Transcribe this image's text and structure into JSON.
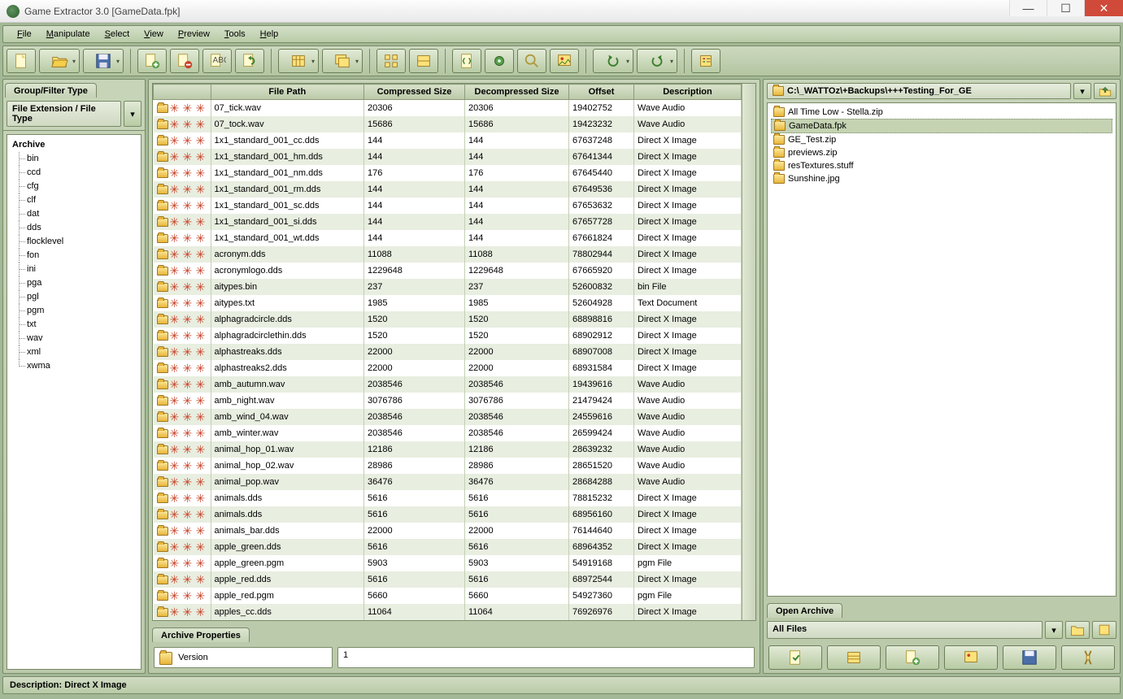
{
  "window": {
    "title": "Game Extractor 3.0 [GameData.fpk]"
  },
  "menu": {
    "items": [
      "File",
      "Manipulate",
      "Select",
      "View",
      "Preview",
      "Tools",
      "Help"
    ]
  },
  "left": {
    "tab": "Group/Filter Type",
    "selector": "File Extension / File Type",
    "tree_root": "Archive",
    "tree": [
      "bin",
      "ccd",
      "cfg",
      "clf",
      "dat",
      "dds",
      "flocklevel",
      "fon",
      "ini",
      "pga",
      "pgl",
      "pgm",
      "txt",
      "wav",
      "xml",
      "xwma"
    ]
  },
  "columns": [
    "",
    "File Path",
    "Compressed Size",
    "Decompressed Size",
    "Offset",
    "Description"
  ],
  "rows": [
    {
      "name": "07_tick.wav",
      "comp": "20306",
      "decomp": "20306",
      "off": "19402752",
      "desc": "Wave Audio"
    },
    {
      "name": "07_tock.wav",
      "comp": "15686",
      "decomp": "15686",
      "off": "19423232",
      "desc": "Wave Audio"
    },
    {
      "name": "1x1_standard_001_cc.dds",
      "comp": "144",
      "decomp": "144",
      "off": "67637248",
      "desc": "Direct X Image"
    },
    {
      "name": "1x1_standard_001_hm.dds",
      "comp": "144",
      "decomp": "144",
      "off": "67641344",
      "desc": "Direct X Image"
    },
    {
      "name": "1x1_standard_001_nm.dds",
      "comp": "176",
      "decomp": "176",
      "off": "67645440",
      "desc": "Direct X Image"
    },
    {
      "name": "1x1_standard_001_rm.dds",
      "comp": "144",
      "decomp": "144",
      "off": "67649536",
      "desc": "Direct X Image"
    },
    {
      "name": "1x1_standard_001_sc.dds",
      "comp": "144",
      "decomp": "144",
      "off": "67653632",
      "desc": "Direct X Image"
    },
    {
      "name": "1x1_standard_001_si.dds",
      "comp": "144",
      "decomp": "144",
      "off": "67657728",
      "desc": "Direct X Image"
    },
    {
      "name": "1x1_standard_001_wt.dds",
      "comp": "144",
      "decomp": "144",
      "off": "67661824",
      "desc": "Direct X Image"
    },
    {
      "name": "acronym.dds",
      "comp": "11088",
      "decomp": "11088",
      "off": "78802944",
      "desc": "Direct X Image"
    },
    {
      "name": "acronymlogo.dds",
      "comp": "1229648",
      "decomp": "1229648",
      "off": "67665920",
      "desc": "Direct X Image"
    },
    {
      "name": "aitypes.bin",
      "comp": "237",
      "decomp": "237",
      "off": "52600832",
      "desc": "bin File"
    },
    {
      "name": "aitypes.txt",
      "comp": "1985",
      "decomp": "1985",
      "off": "52604928",
      "desc": "Text Document"
    },
    {
      "name": "alphagradcircle.dds",
      "comp": "1520",
      "decomp": "1520",
      "off": "68898816",
      "desc": "Direct X Image"
    },
    {
      "name": "alphagradcirclethin.dds",
      "comp": "1520",
      "decomp": "1520",
      "off": "68902912",
      "desc": "Direct X Image"
    },
    {
      "name": "alphastreaks.dds",
      "comp": "22000",
      "decomp": "22000",
      "off": "68907008",
      "desc": "Direct X Image"
    },
    {
      "name": "alphastreaks2.dds",
      "comp": "22000",
      "decomp": "22000",
      "off": "68931584",
      "desc": "Direct X Image"
    },
    {
      "name": "amb_autumn.wav",
      "comp": "2038546",
      "decomp": "2038546",
      "off": "19439616",
      "desc": "Wave Audio"
    },
    {
      "name": "amb_night.wav",
      "comp": "3076786",
      "decomp": "3076786",
      "off": "21479424",
      "desc": "Wave Audio"
    },
    {
      "name": "amb_wind_04.wav",
      "comp": "2038546",
      "decomp": "2038546",
      "off": "24559616",
      "desc": "Wave Audio"
    },
    {
      "name": "amb_winter.wav",
      "comp": "2038546",
      "decomp": "2038546",
      "off": "26599424",
      "desc": "Wave Audio"
    },
    {
      "name": "animal_hop_01.wav",
      "comp": "12186",
      "decomp": "12186",
      "off": "28639232",
      "desc": "Wave Audio"
    },
    {
      "name": "animal_hop_02.wav",
      "comp": "28986",
      "decomp": "28986",
      "off": "28651520",
      "desc": "Wave Audio"
    },
    {
      "name": "animal_pop.wav",
      "comp": "36476",
      "decomp": "36476",
      "off": "28684288",
      "desc": "Wave Audio"
    },
    {
      "name": "animals.dds",
      "comp": "5616",
      "decomp": "5616",
      "off": "78815232",
      "desc": "Direct X Image"
    },
    {
      "name": "animals.dds",
      "comp": "5616",
      "decomp": "5616",
      "off": "68956160",
      "desc": "Direct X Image"
    },
    {
      "name": "animals_bar.dds",
      "comp": "22000",
      "decomp": "22000",
      "off": "76144640",
      "desc": "Direct X Image"
    },
    {
      "name": "apple_green.dds",
      "comp": "5616",
      "decomp": "5616",
      "off": "68964352",
      "desc": "Direct X Image"
    },
    {
      "name": "apple_green.pgm",
      "comp": "5903",
      "decomp": "5903",
      "off": "54919168",
      "desc": "pgm File"
    },
    {
      "name": "apple_red.dds",
      "comp": "5616",
      "decomp": "5616",
      "off": "68972544",
      "desc": "Direct X Image"
    },
    {
      "name": "apple_red.pgm",
      "comp": "5660",
      "decomp": "5660",
      "off": "54927360",
      "desc": "pgm File"
    },
    {
      "name": "apples_cc.dds",
      "comp": "11064",
      "decomp": "11064",
      "off": "76926976",
      "desc": "Direct X Image"
    }
  ],
  "center": {
    "bottom_tab": "Archive Properties",
    "prop_label": "Version",
    "prop_value": "1"
  },
  "right": {
    "path": "C:\\_WATTOz\\+Backups\\+++Testing_For_GE",
    "files": [
      {
        "name": "All Time Low - Stella.zip",
        "sel": false
      },
      {
        "name": "GameData.fpk",
        "sel": true
      },
      {
        "name": "GE_Test.zip",
        "sel": false
      },
      {
        "name": "previews.zip",
        "sel": false
      },
      {
        "name": "resTextures.stuff",
        "sel": false
      },
      {
        "name": "Sunshine.jpg",
        "sel": false
      }
    ],
    "tab": "Open Archive",
    "filter": "All Files"
  },
  "status": "Description: Direct X Image"
}
